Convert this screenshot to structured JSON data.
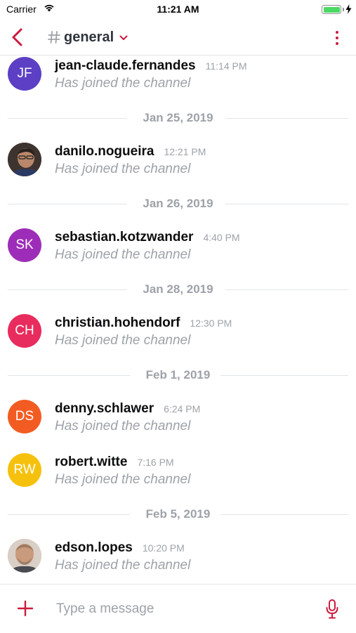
{
  "status_bar": {
    "carrier": "Carrier",
    "time": "11:21 AM",
    "icons": [
      "wifi-icon",
      "battery-icon",
      "charging-bolt-icon"
    ]
  },
  "header": {
    "back_icon": "chevron-left-icon",
    "channel_prefix_icon": "hash-icon",
    "channel_name": "general",
    "dropdown_icon": "chevron-down-icon",
    "menu_icon": "kebab-menu-icon"
  },
  "messages": [
    {
      "type": "message",
      "initials": "JF",
      "avatar_color": "#5c3fc4",
      "username": "jean-claude.fernandes",
      "time": "11:14 PM",
      "text": "Has joined the channel"
    },
    {
      "type": "separator",
      "label": "Jan 25, 2019"
    },
    {
      "type": "message",
      "initials": "",
      "avatar_color": "#6d5a4d",
      "photo": true,
      "username": "danilo.nogueira",
      "time": "12:21 PM",
      "text": "Has joined the channel"
    },
    {
      "type": "separator",
      "label": "Jan 26, 2019"
    },
    {
      "type": "message",
      "initials": "SK",
      "avatar_color": "#9d2db8",
      "username": "sebastian.kotzwander",
      "time": "4:40 PM",
      "text": "Has joined the channel"
    },
    {
      "type": "separator",
      "label": "Jan 28, 2019"
    },
    {
      "type": "message",
      "initials": "CH",
      "avatar_color": "#e82c5d",
      "username": "christian.hohendorf",
      "time": "12:30 PM",
      "text": "Has joined the channel"
    },
    {
      "type": "separator",
      "label": "Feb 1, 2019"
    },
    {
      "type": "message",
      "initials": "DS",
      "avatar_color": "#f25c22",
      "username": "denny.schlawer",
      "time": "6:24 PM",
      "text": "Has joined the channel"
    },
    {
      "type": "message",
      "initials": "RW",
      "avatar_color": "#f5c10d",
      "username": "robert.witte",
      "time": "7:16 PM",
      "text": "Has joined the channel"
    },
    {
      "type": "separator",
      "label": "Feb 5, 2019"
    },
    {
      "type": "message",
      "initials": "",
      "avatar_color": "#c49a7e",
      "photo": true,
      "username": "edson.lopes",
      "time": "10:20 PM",
      "text": "Has joined the channel"
    }
  ],
  "composer": {
    "add_icon": "plus-icon",
    "placeholder": "Type a message",
    "mic_icon": "microphone-icon"
  },
  "colors": {
    "accent": "#cb1b3d",
    "muted_text": "#9ea2a8",
    "separator_line": "#e1e5e8"
  }
}
